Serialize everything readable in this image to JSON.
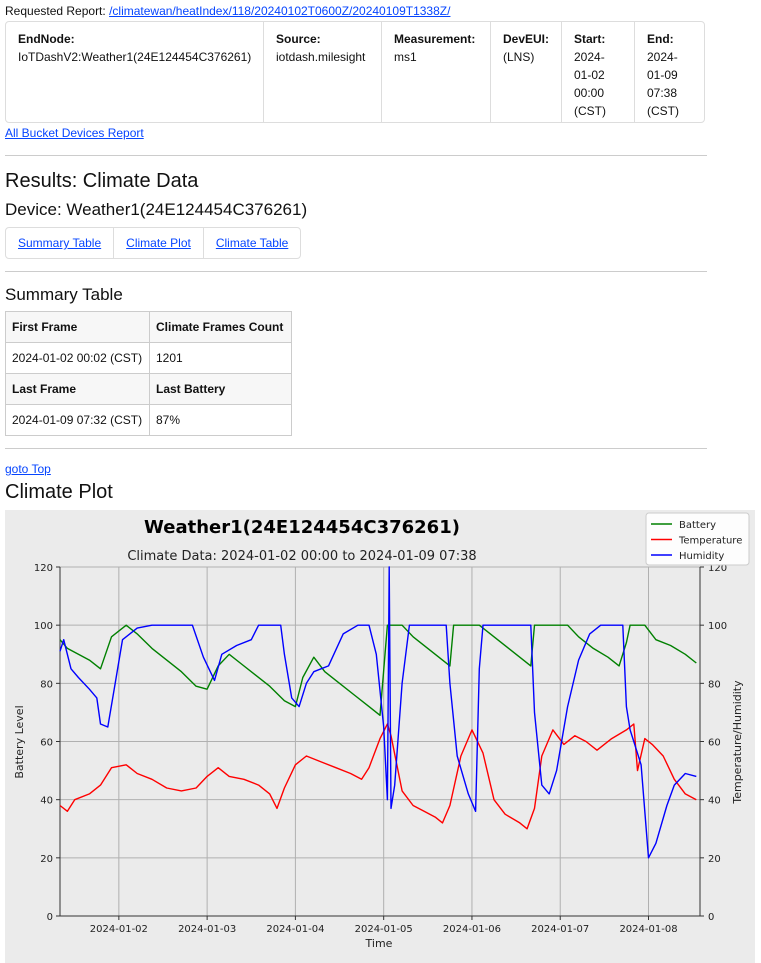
{
  "report": {
    "requested_label": "Requested Report:",
    "requested_link": "/climatewan/heatIndex/118/20240102T0600Z/20240109T1338Z/"
  },
  "params": [
    {
      "label": "EndNode:",
      "value": "IoTDashV2:Weather1(24E124454C376261)"
    },
    {
      "label": "Source:",
      "value": "iotdash.milesight"
    },
    {
      "label": "Measurement:",
      "value": "ms1"
    },
    {
      "label": "DevEUI:",
      "value": "(LNS)"
    },
    {
      "label": "Start:",
      "lines": [
        "2024-",
        "01-02",
        "00:00",
        "(CST)"
      ]
    },
    {
      "label": "End:",
      "lines": [
        "2024-",
        "01-09",
        "07:38",
        "(CST)"
      ]
    }
  ],
  "all_bucket_link": "All Bucket Devices Report",
  "results_title": "Results: Climate Data",
  "device_title": "Device: Weather1(24E124454C376261)",
  "tabs": [
    "Summary Table",
    "Climate Plot",
    "Climate Table"
  ],
  "summary": {
    "title": "Summary Table",
    "h1": "First Frame",
    "h2": "Climate Frames Count",
    "v1": "2024-01-02 00:02 (CST)",
    "v2": "1201",
    "h3": "Last Frame",
    "h4": "Last Battery",
    "v3": "2024-01-09 07:32 (CST)",
    "v4": "87%"
  },
  "goto_top": "goto Top",
  "plot_section_title": "Climate Plot",
  "colors": {
    "battery": "#008000",
    "temperature": "#ff0000",
    "humidity": "#0000ff",
    "link": "#0645ff"
  },
  "chart_data": {
    "type": "line",
    "title": "Weather1(24E124454C376261)",
    "subtitle": "Climate Data: 2024-01-02 00:00 to 2024-01-09 07:38",
    "xlabel": "Time",
    "ylabel_left": "Battery Level",
    "ylabel_right": "Temperature/Humidity",
    "xlim": [
      "2024-01-01T08:00",
      "2024-01-08T14:00"
    ],
    "ylim": [
      0,
      120
    ],
    "yticks": [
      0,
      20,
      40,
      60,
      80,
      100,
      120
    ],
    "xtick_labels": [
      "2024-01-02",
      "2024-01-03",
      "2024-01-04",
      "2024-01-05",
      "2024-01-06",
      "2024-01-07",
      "2024-01-08"
    ],
    "grid": true,
    "legend_position": "top-right",
    "series": [
      {
        "name": "Battery",
        "color": "#008000",
        "points": [
          [
            "2024-01-01T08:00",
            95
          ],
          [
            "2024-01-01T10:00",
            92
          ],
          [
            "2024-01-01T13:00",
            90
          ],
          [
            "2024-01-01T16:00",
            88
          ],
          [
            "2024-01-01T19:00",
            85
          ],
          [
            "2024-01-01T22:00",
            96
          ],
          [
            "2024-01-02T02:00",
            100
          ],
          [
            "2024-01-02T05:00",
            97
          ],
          [
            "2024-01-02T09:00",
            92
          ],
          [
            "2024-01-02T13:00",
            88
          ],
          [
            "2024-01-02T17:00",
            84
          ],
          [
            "2024-01-02T21:00",
            79
          ],
          [
            "2024-01-03T00:00",
            78
          ],
          [
            "2024-01-03T03:00",
            86
          ],
          [
            "2024-01-03T06:00",
            90
          ],
          [
            "2024-01-03T09:00",
            87
          ],
          [
            "2024-01-03T13:00",
            83
          ],
          [
            "2024-01-03T17:00",
            79
          ],
          [
            "2024-01-03T21:00",
            74
          ],
          [
            "2024-01-04T00:00",
            72
          ],
          [
            "2024-01-04T02:00",
            82
          ],
          [
            "2024-01-04T05:00",
            89
          ],
          [
            "2024-01-04T08:00",
            84
          ],
          [
            "2024-01-04T12:00",
            80
          ],
          [
            "2024-01-04T16:00",
            76
          ],
          [
            "2024-01-04T20:00",
            72
          ],
          [
            "2024-01-04T23:00",
            69
          ],
          [
            "2024-01-05T01:00",
            100
          ],
          [
            "2024-01-05T05:00",
            100
          ],
          [
            "2024-01-05T08:00",
            96
          ],
          [
            "2024-01-05T12:00",
            92
          ],
          [
            "2024-01-05T16:00",
            88
          ],
          [
            "2024-01-05T18:00",
            86
          ],
          [
            "2024-01-05T19:00",
            100
          ],
          [
            "2024-01-06T02:00",
            100
          ],
          [
            "2024-01-06T06:00",
            96
          ],
          [
            "2024-01-06T10:00",
            92
          ],
          [
            "2024-01-06T14:00",
            88
          ],
          [
            "2024-01-06T16:00",
            86
          ],
          [
            "2024-01-06T17:00",
            100
          ],
          [
            "2024-01-07T02:00",
            100
          ],
          [
            "2024-01-07T05:00",
            96
          ],
          [
            "2024-01-07T09:00",
            92
          ],
          [
            "2024-01-07T13:00",
            89
          ],
          [
            "2024-01-07T16:00",
            86
          ],
          [
            "2024-01-07T18:00",
            94
          ],
          [
            "2024-01-07T19:00",
            100
          ],
          [
            "2024-01-07T23:00",
            100
          ],
          [
            "2024-01-08T02:00",
            95
          ],
          [
            "2024-01-08T06:00",
            93
          ],
          [
            "2024-01-08T10:00",
            90
          ],
          [
            "2024-01-08T13:00",
            87
          ]
        ]
      },
      {
        "name": "Temperature",
        "color": "#ff0000",
        "points": [
          [
            "2024-01-01T08:00",
            38
          ],
          [
            "2024-01-01T10:00",
            36
          ],
          [
            "2024-01-01T12:00",
            40
          ],
          [
            "2024-01-01T16:00",
            42
          ],
          [
            "2024-01-01T19:00",
            45
          ],
          [
            "2024-01-01T22:00",
            51
          ],
          [
            "2024-01-02T02:00",
            52
          ],
          [
            "2024-01-02T05:00",
            49
          ],
          [
            "2024-01-02T09:00",
            47
          ],
          [
            "2024-01-02T13:00",
            44
          ],
          [
            "2024-01-02T17:00",
            43
          ],
          [
            "2024-01-02T21:00",
            44
          ],
          [
            "2024-01-03T00:00",
            48
          ],
          [
            "2024-01-03T03:00",
            51
          ],
          [
            "2024-01-03T06:00",
            48
          ],
          [
            "2024-01-03T10:00",
            47
          ],
          [
            "2024-01-03T14:00",
            45
          ],
          [
            "2024-01-03T17:00",
            42
          ],
          [
            "2024-01-03T19:00",
            37
          ],
          [
            "2024-01-03T21:00",
            44
          ],
          [
            "2024-01-04T00:00",
            52
          ],
          [
            "2024-01-04T03:00",
            55
          ],
          [
            "2024-01-04T07:00",
            53
          ],
          [
            "2024-01-04T11:00",
            51
          ],
          [
            "2024-01-04T15:00",
            49
          ],
          [
            "2024-01-04T18:00",
            47
          ],
          [
            "2024-01-04T20:00",
            51
          ],
          [
            "2024-01-04T23:00",
            61
          ],
          [
            "2024-01-05T01:00",
            66
          ],
          [
            "2024-01-05T02:00",
            62
          ],
          [
            "2024-01-05T05:00",
            43
          ],
          [
            "2024-01-05T08:00",
            38
          ],
          [
            "2024-01-05T11:00",
            36
          ],
          [
            "2024-01-05T14:00",
            34
          ],
          [
            "2024-01-05T16:00",
            32
          ],
          [
            "2024-01-05T18:00",
            38
          ],
          [
            "2024-01-05T21:00",
            55
          ],
          [
            "2024-01-06T00:00",
            64
          ],
          [
            "2024-01-06T03:00",
            56
          ],
          [
            "2024-01-06T06:00",
            40
          ],
          [
            "2024-01-06T09:00",
            35
          ],
          [
            "2024-01-06T13:00",
            32
          ],
          [
            "2024-01-06T15:00",
            30
          ],
          [
            "2024-01-06T17:00",
            37
          ],
          [
            "2024-01-06T19:00",
            55
          ],
          [
            "2024-01-06T22:00",
            64
          ],
          [
            "2024-01-07T01:00",
            59
          ],
          [
            "2024-01-07T04:00",
            62
          ],
          [
            "2024-01-07T07:00",
            60
          ],
          [
            "2024-01-07T10:00",
            57
          ],
          [
            "2024-01-07T14:00",
            61
          ],
          [
            "2024-01-07T18:00",
            64
          ],
          [
            "2024-01-07T20:00",
            66
          ],
          [
            "2024-01-07T21:00",
            50
          ],
          [
            "2024-01-07T23:00",
            61
          ],
          [
            "2024-01-08T01:00",
            59
          ],
          [
            "2024-01-08T04:00",
            55
          ],
          [
            "2024-01-08T07:00",
            47
          ],
          [
            "2024-01-08T10:00",
            42
          ],
          [
            "2024-01-08T13:00",
            40
          ]
        ]
      },
      {
        "name": "Humidity",
        "color": "#0000ff",
        "points": [
          [
            "2024-01-01T08:00",
            91
          ],
          [
            "2024-01-01T09:00",
            95
          ],
          [
            "2024-01-01T11:00",
            85
          ],
          [
            "2024-01-01T13:00",
            82
          ],
          [
            "2024-01-01T16:00",
            78
          ],
          [
            "2024-01-01T18:00",
            75
          ],
          [
            "2024-01-01T19:00",
            66
          ],
          [
            "2024-01-01T21:00",
            65
          ],
          [
            "2024-01-01T23:00",
            80
          ],
          [
            "2024-01-02T01:00",
            95
          ],
          [
            "2024-01-02T05:00",
            99
          ],
          [
            "2024-01-02T09:00",
            100
          ],
          [
            "2024-01-02T14:00",
            100
          ],
          [
            "2024-01-02T20:00",
            100
          ],
          [
            "2024-01-02T23:00",
            89
          ],
          [
            "2024-01-03T02:00",
            81
          ],
          [
            "2024-01-03T04:00",
            90
          ],
          [
            "2024-01-03T08:00",
            93
          ],
          [
            "2024-01-03T12:00",
            95
          ],
          [
            "2024-01-03T14:00",
            100
          ],
          [
            "2024-01-03T20:00",
            100
          ],
          [
            "2024-01-03T21:00",
            90
          ],
          [
            "2024-01-03T23:00",
            75
          ],
          [
            "2024-01-04T01:00",
            72
          ],
          [
            "2024-01-04T03:00",
            80
          ],
          [
            "2024-01-04T05:00",
            84
          ],
          [
            "2024-01-04T09:00",
            86
          ],
          [
            "2024-01-04T13:00",
            97
          ],
          [
            "2024-01-04T17:00",
            100
          ],
          [
            "2024-01-04T20:00",
            100
          ],
          [
            "2024-01-04T22:00",
            90
          ],
          [
            "2024-01-05T00:00",
            65
          ],
          [
            "2024-01-05T01:00",
            40
          ],
          [
            "2024-01-05T01:30",
            120
          ],
          [
            "2024-01-05T02:00",
            37
          ],
          [
            "2024-01-05T03:00",
            45
          ],
          [
            "2024-01-05T05:00",
            80
          ],
          [
            "2024-01-05T07:00",
            100
          ],
          [
            "2024-01-05T11:00",
            100
          ],
          [
            "2024-01-05T15:00",
            100
          ],
          [
            "2024-01-05T17:00",
            100
          ],
          [
            "2024-01-05T18:00",
            80
          ],
          [
            "2024-01-05T20:00",
            55
          ],
          [
            "2024-01-05T23:00",
            42
          ],
          [
            "2024-01-06T01:00",
            36
          ],
          [
            "2024-01-06T02:00",
            85
          ],
          [
            "2024-01-06T03:00",
            100
          ],
          [
            "2024-01-06T09:00",
            100
          ],
          [
            "2024-01-06T13:00",
            100
          ],
          [
            "2024-01-06T16:00",
            100
          ],
          [
            "2024-01-06T17:00",
            70
          ],
          [
            "2024-01-06T19:00",
            45
          ],
          [
            "2024-01-06T21:00",
            42
          ],
          [
            "2024-01-06T23:00",
            50
          ],
          [
            "2024-01-07T02:00",
            72
          ],
          [
            "2024-01-07T05:00",
            88
          ],
          [
            "2024-01-07T08:00",
            97
          ],
          [
            "2024-01-07T11:00",
            100
          ],
          [
            "2024-01-07T15:00",
            100
          ],
          [
            "2024-01-07T17:00",
            100
          ],
          [
            "2024-01-07T18:00",
            72
          ],
          [
            "2024-01-07T19:00",
            64
          ],
          [
            "2024-01-07T20:00",
            60
          ],
          [
            "2024-01-07T22:00",
            52
          ],
          [
            "2024-01-08T00:00",
            20
          ],
          [
            "2024-01-08T02:00",
            25
          ],
          [
            "2024-01-08T05:00",
            38
          ],
          [
            "2024-01-08T07:00",
            45
          ],
          [
            "2024-01-08T10:00",
            49
          ],
          [
            "2024-01-08T13:00",
            48
          ]
        ]
      }
    ]
  }
}
